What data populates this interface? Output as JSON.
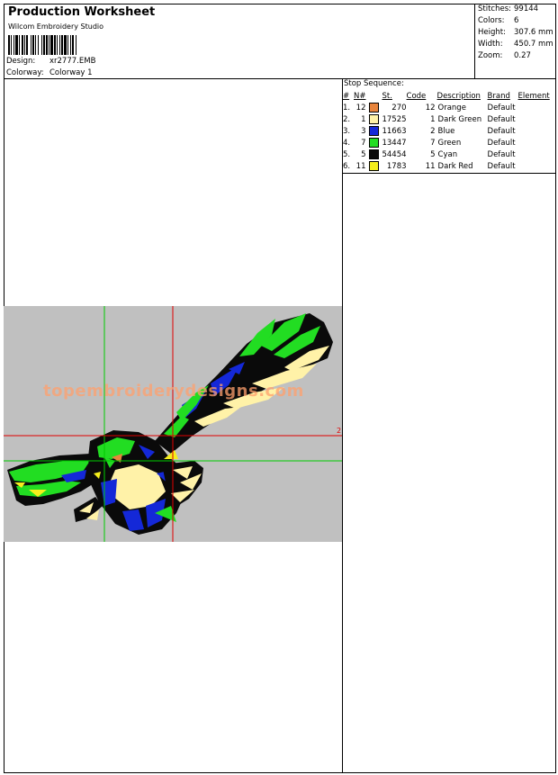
{
  "header": {
    "title": "Production Worksheet",
    "software": "Wilcom Embroidery Studio",
    "design_label": "Design:",
    "design_value": "xr2777.EMB",
    "colorway_label": "Colorway:",
    "colorway_value": "Colorway 1"
  },
  "stats": [
    {
      "label": "Stitches:",
      "value": "99144"
    },
    {
      "label": "Colors:",
      "value": "6"
    },
    {
      "label": "Height:",
      "value": "307.6 mm"
    },
    {
      "label": "Width:",
      "value": "450.7 mm"
    },
    {
      "label": "Zoom:",
      "value": "0.27"
    }
  ],
  "stop_sequence": {
    "heading": "Stop Sequence:",
    "columns": [
      "#",
      "N#",
      "St.",
      "Code",
      "Description",
      "Brand",
      "Element"
    ],
    "rows": [
      {
        "num": "1.",
        "n": "12",
        "color": "#e8843c",
        "st": "270",
        "code": "12",
        "desc": "Orange",
        "brand": "Default",
        "element": ""
      },
      {
        "num": "2.",
        "n": "1",
        "color": "#fff2a8",
        "st": "17525",
        "code": "1",
        "desc": "Dark Green",
        "brand": "Default",
        "element": ""
      },
      {
        "num": "3.",
        "n": "3",
        "color": "#1428d8",
        "st": "11663",
        "code": "2",
        "desc": "Blue",
        "brand": "Default",
        "element": ""
      },
      {
        "num": "4.",
        "n": "7",
        "color": "#22dd22",
        "st": "13447",
        "code": "7",
        "desc": "Green",
        "brand": "Default",
        "element": ""
      },
      {
        "num": "5.",
        "n": "5",
        "color": "#0a0a0a",
        "st": "54454",
        "code": "5",
        "desc": "Cyan",
        "brand": "Default",
        "element": ""
      },
      {
        "num": "6.",
        "n": "11",
        "color": "#f4ee1c",
        "st": "1783",
        "code": "11",
        "desc": "Dark Red",
        "brand": "Default",
        "element": ""
      }
    ]
  },
  "preview": {
    "background": "#c0c0c0",
    "watermark": "topembroiderydesigns.com",
    "marker_label": "2",
    "crosshair_red": "#e00000",
    "crosshair_green": "#00cc00",
    "palette": {
      "black": "#0a0a0a",
      "green": "#22dd22",
      "blue": "#1428d8",
      "cream": "#fff2a8",
      "yellow": "#f4ee1c",
      "orange": "#e8843c"
    }
  }
}
